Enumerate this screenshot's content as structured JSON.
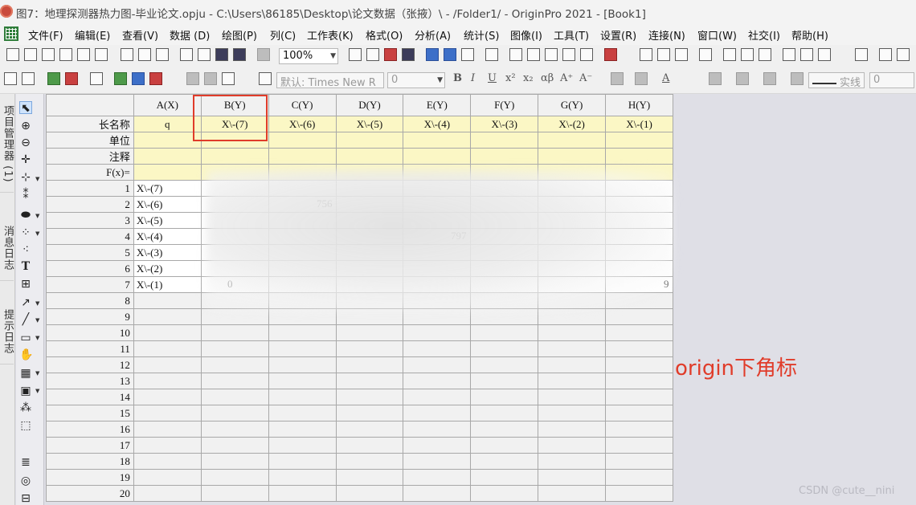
{
  "window": {
    "title": "图7：地理探测器热力图-毕业论文.opju - C:\\Users\\86185\\Desktop\\论文数据（张掖）\\ - /Folder1/ - OriginPro 2021 - [Book1]"
  },
  "menu": [
    "文件(F)",
    "编辑(E)",
    "查看(V)",
    "数据 (D)",
    "绘图(P)",
    "列(C)",
    "工作表(K)",
    "格式(O)",
    "分析(A)",
    "统计(S)",
    "图像(I)",
    "工具(T)",
    "设置(R)",
    "连接(N)",
    "窗口(W)",
    "社交(I)",
    "帮助(H)"
  ],
  "toolbar": {
    "zoom": "100%",
    "font": "默认: Times New R",
    "font_size": "0",
    "line_style": "实线",
    "line_width": "0"
  },
  "left_tabs": [
    "项目管理器 (1)",
    "消息日志",
    "提示日志"
  ],
  "sheet": {
    "corner": "",
    "columns": [
      "A(X)",
      "B(Y)",
      "C(Y)",
      "D(Y)",
      "E(Y)",
      "F(Y)",
      "G(Y)",
      "H(Y)"
    ],
    "meta_labels": [
      "长名称",
      "单位",
      "注释",
      "F(x)="
    ],
    "long_names": [
      "q",
      "X\\-(7)",
      "X\\-(6)",
      "X\\-(5)",
      "X\\-(4)",
      "X\\-(3)",
      "X\\-(2)",
      "X\\-(1)"
    ],
    "row_numbers": [
      "1",
      "2",
      "3",
      "4",
      "5",
      "6",
      "7",
      "8",
      "9",
      "10",
      "11",
      "12",
      "13",
      "14",
      "15",
      "16",
      "17",
      "18",
      "19",
      "20"
    ],
    "col_a_values": [
      "X\\-(7)",
      "X\\-(6)",
      "X\\-(5)",
      "X\\-(4)",
      "X\\-(3)",
      "X\\-(2)",
      "X\\-(1)"
    ],
    "partial_values": {
      "c2": "756",
      "e4": "797",
      "b7": "0",
      "h7": "9"
    }
  },
  "annotation": "origin下角标",
  "watermark": "CSDN @cute__nini",
  "colors": {
    "highlight": "#e03c2a",
    "meta_bg": "#fbf7c5",
    "header_bg": "#f1f1f1"
  }
}
